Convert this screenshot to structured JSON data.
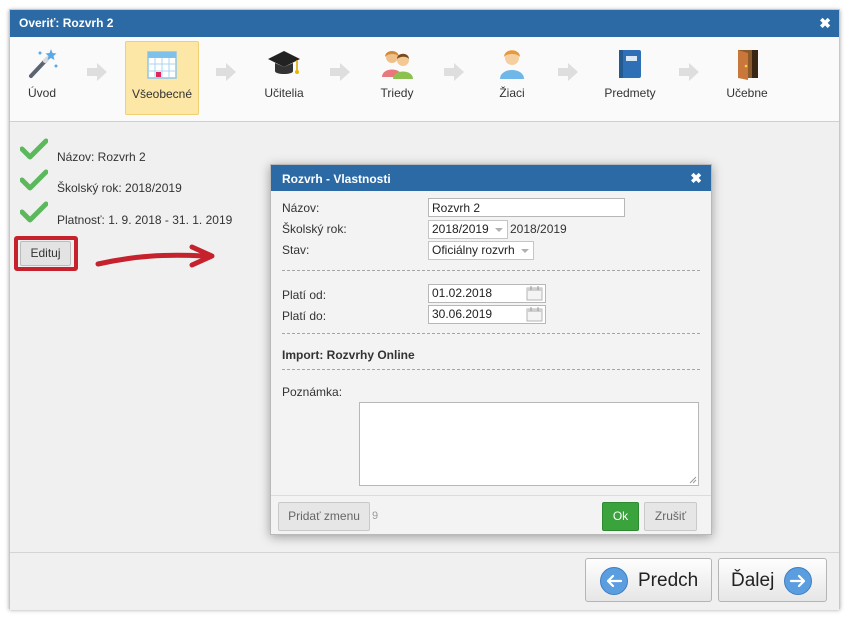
{
  "window": {
    "title": "Overiť: Rozvrh 2",
    "close_symbol": "✖"
  },
  "wizard": {
    "steps": [
      {
        "label": "Úvod",
        "icon": "magic-wand-icon"
      },
      {
        "label": "Všeobecné",
        "icon": "calendar-grid-icon",
        "active": true
      },
      {
        "label": "Učitelia",
        "icon": "graduation-cap-icon"
      },
      {
        "label": "Triedy",
        "icon": "class-people-icon"
      },
      {
        "label": "Žiaci",
        "icon": "student-icon"
      },
      {
        "label": "Predmety",
        "icon": "book-icon"
      },
      {
        "label": "Učebne",
        "icon": "door-icon"
      }
    ]
  },
  "summary": {
    "items": [
      "Názov: Rozvrh 2",
      "Školský rok: 2018/2019",
      "Platnosť: 1. 9. 2018 - 31. 1. 2019"
    ],
    "edit_label": "Edituj"
  },
  "dialog": {
    "title": "Rozvrh - Vlastnosti",
    "close_symbol": "✖",
    "name_label": "Názov:",
    "name_value": "Rozvrh 2",
    "year_label": "Školský rok:",
    "year_value": "2018/2019",
    "year_text": "2018/2019",
    "status_label": "Stav:",
    "status_value": "Oficiálny rozvrh",
    "valid_from_label": "Platí od:",
    "valid_from_value": "01.02.2018",
    "valid_to_label": "Platí do:",
    "valid_to_value": "30.06.2019",
    "import_label": "Import: Rozvrhy Online",
    "note_label": "Poznámka:",
    "note_value": "",
    "add_change_label": "Pridať zmenu",
    "add_change_count": "9",
    "ok_label": "Ok",
    "cancel_label": "Zrušiť"
  },
  "footer": {
    "prev_label": "Predch",
    "next_label": "Ďalej"
  },
  "colors": {
    "accent": "#2c6aa5",
    "active_step": "#fce7a6",
    "ok_green": "#3aa33c",
    "highlight_red": "#c5222d"
  }
}
